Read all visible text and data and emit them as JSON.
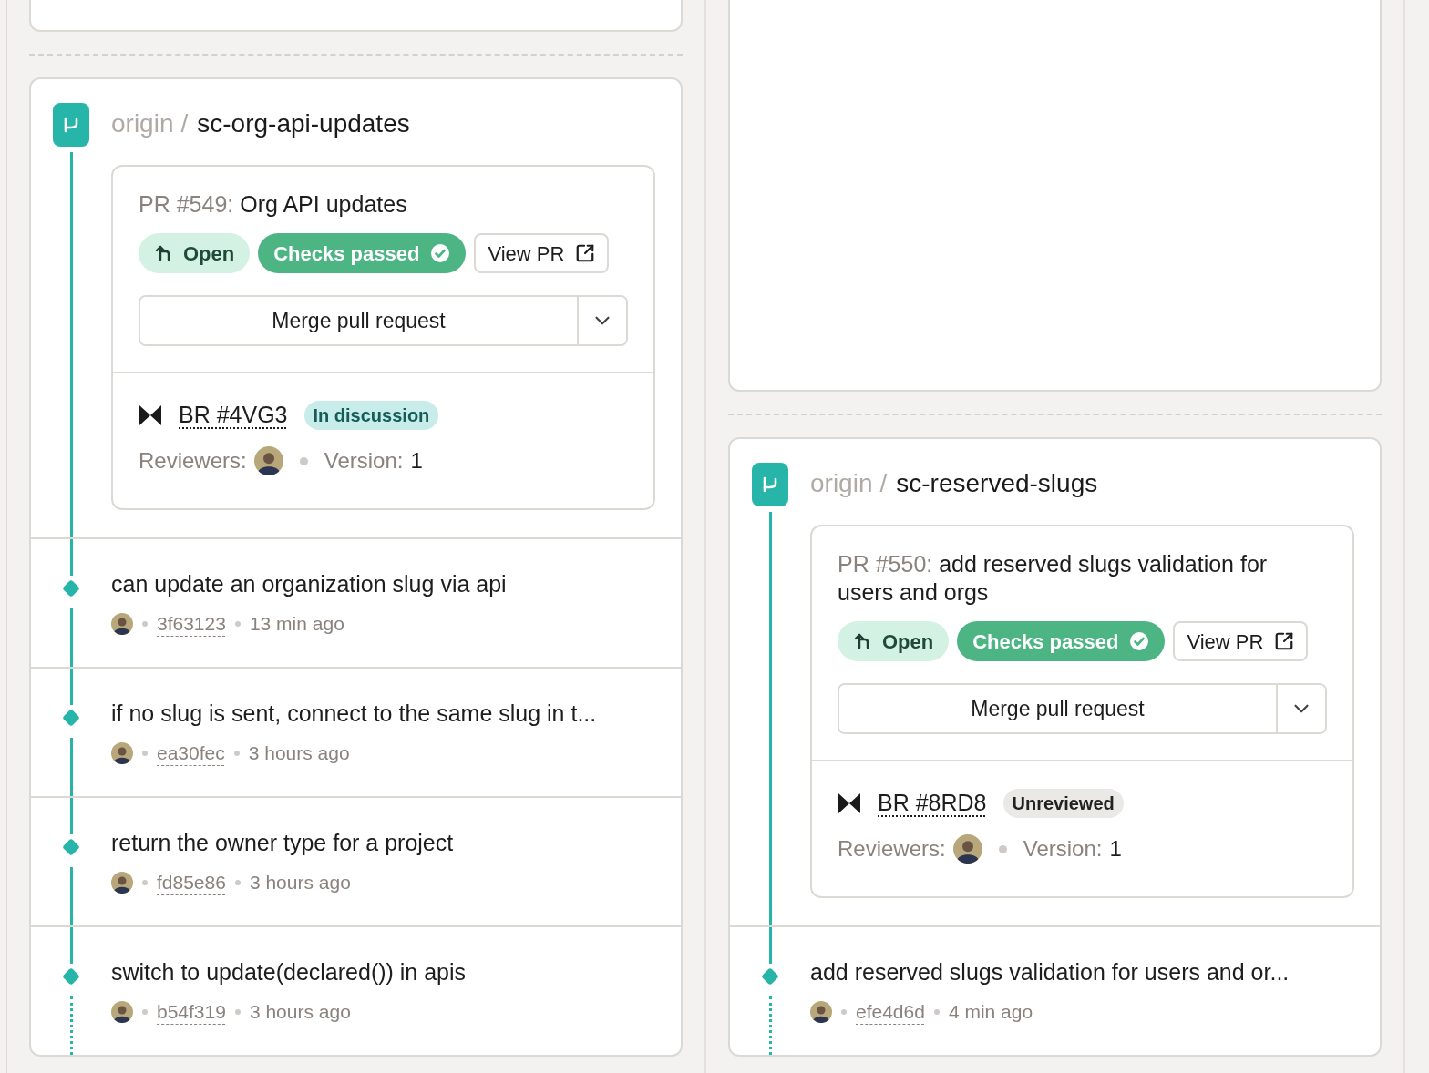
{
  "columns": [
    {
      "branch": {
        "remote": "origin",
        "separator": "/",
        "name": "sc-org-api-updates",
        "pr": {
          "number": "PR #549:",
          "title": "Org API updates",
          "state": "Open",
          "checks": "Checks passed",
          "view": "View PR",
          "merge": "Merge pull request"
        },
        "review": {
          "id": "BR #4VG3",
          "status": "In discussion",
          "kind": "discussion",
          "reviewers_label": "Reviewers:",
          "version_label": "Version:",
          "version": "1"
        },
        "commits": [
          {
            "message": "can update an organization slug via api",
            "hash": "3f63123",
            "time": "13 min ago"
          },
          {
            "message": "if no slug is sent, connect to the same slug in t...",
            "hash": "ea30fec",
            "time": "3 hours ago"
          },
          {
            "message": "return the owner type for a project",
            "hash": "fd85e86",
            "time": "3 hours ago"
          },
          {
            "message": "switch to update(declared()) in apis",
            "hash": "b54f319",
            "time": "3 hours ago"
          }
        ]
      }
    },
    {
      "branch": {
        "remote": "origin",
        "separator": "/",
        "name": "sc-reserved-slugs",
        "pr": {
          "number": "PR #550:",
          "title": "add reserved slugs validation for users and orgs",
          "state": "Open",
          "checks": "Checks passed",
          "view": "View PR",
          "merge": "Merge pull request"
        },
        "review": {
          "id": "BR #8RD8",
          "status": "Unreviewed",
          "kind": "unreviewed",
          "reviewers_label": "Reviewers:",
          "version_label": "Version:",
          "version": "1"
        },
        "commits": [
          {
            "message": "add reserved slugs validation for users and or...",
            "hash": "efe4d6d",
            "time": "4 min ago"
          }
        ]
      }
    }
  ]
}
